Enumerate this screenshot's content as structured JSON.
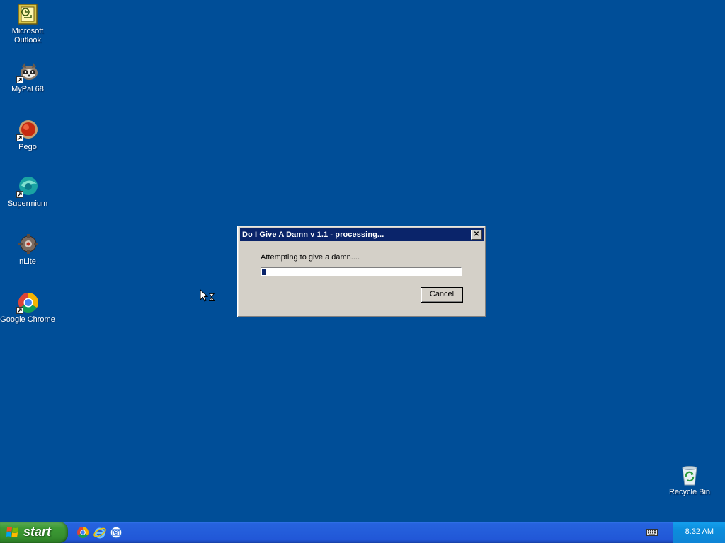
{
  "desktop": {
    "icons": [
      {
        "label": "Microsoft Outlook",
        "icon": "outlook-icon"
      },
      {
        "label": "MyPal 68",
        "icon": "mypal-icon"
      },
      {
        "label": "Pego",
        "icon": "pego-icon"
      },
      {
        "label": "Supermium",
        "icon": "supermium-icon"
      },
      {
        "label": "nLite",
        "icon": "nlite-icon"
      },
      {
        "label": "Google Chrome",
        "icon": "chrome-icon"
      }
    ],
    "recycle_bin": {
      "label": "Recycle Bin",
      "icon": "recycle-bin-icon"
    }
  },
  "dialog": {
    "title": "Do I Give A Damn v 1.1 - processing...",
    "close_label": "✕",
    "message": "Attempting to give a damn....",
    "progress_fraction": 0.02,
    "cancel_label": "Cancel"
  },
  "taskbar": {
    "start_label": "start",
    "quick_launch": [
      "chrome-icon",
      "internet-explorer-icon",
      "outlook-express-icon"
    ],
    "clock": "8:32 AM"
  },
  "colors": {
    "desktop_bg": "#004e98",
    "titlebar": "#0a246a",
    "dialog_bg": "#d4d0c8",
    "taskbar": "#245edb",
    "start_button": "#3c9a34",
    "tray": "#0f8ddc"
  }
}
